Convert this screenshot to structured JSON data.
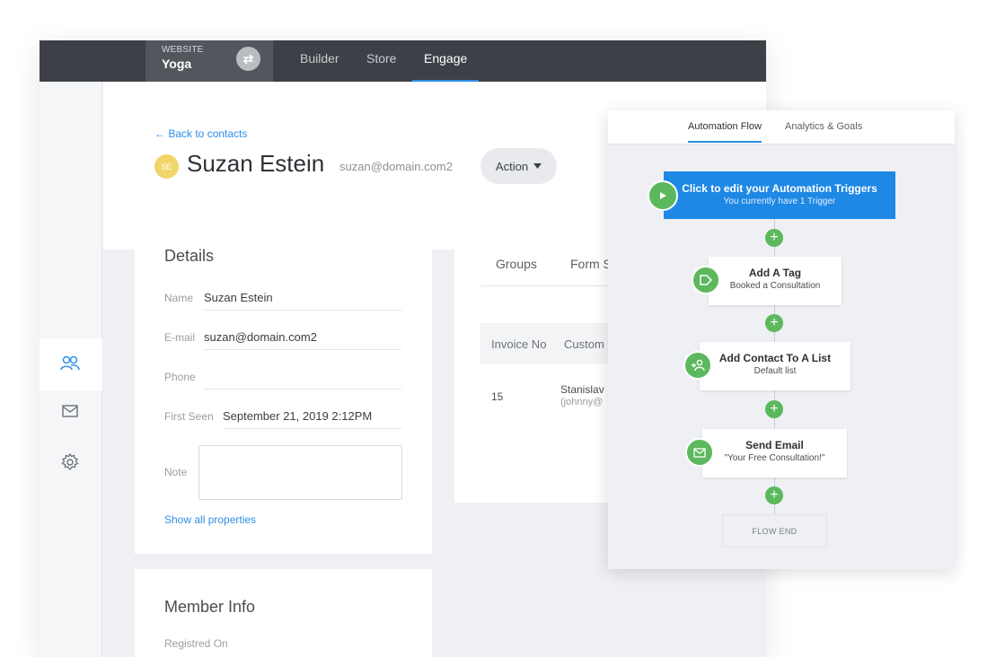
{
  "topbar": {
    "site_kicker": "WEBSITE",
    "site_name": "Yoga",
    "tabs": [
      {
        "label": "Builder"
      },
      {
        "label": "Store"
      },
      {
        "label": "Engage",
        "active": true
      }
    ]
  },
  "rail": {
    "items": [
      {
        "icon": "contacts-icon",
        "active": true
      },
      {
        "icon": "mail-icon"
      },
      {
        "icon": "settings-gear-icon"
      }
    ],
    "help_label": "?"
  },
  "header": {
    "back_link": "← Back to contacts",
    "avatar_initials": "SE",
    "name": "Suzan Estein",
    "email": "suzan@domain.com2",
    "action_label": "Action"
  },
  "details": {
    "title": "Details",
    "fields": [
      {
        "label": "Name",
        "value": "Suzan Estein"
      },
      {
        "label": "E-mail",
        "value": "suzan@domain.com2"
      },
      {
        "label": "Phone",
        "value": ""
      },
      {
        "label": "First Seen",
        "value": "September 21, 2019 2:12PM"
      }
    ],
    "note_label": "Note",
    "show_all": "Show all properties"
  },
  "member": {
    "title": "Member Info",
    "registered_label": "Registred On"
  },
  "right_card": {
    "tabs": [
      "Groups",
      "Form S"
    ],
    "columns": [
      "Invoice No",
      "Custom"
    ],
    "rows": [
      {
        "invoice": "15",
        "customer": "Stanislav",
        "customer_sub": "(johnny@"
      }
    ]
  },
  "flow": {
    "tabs": [
      {
        "label": "Automation Flow",
        "active": true
      },
      {
        "label": "Analytics & Goals"
      }
    ],
    "trigger": {
      "title": "Click to edit your Automation Triggers",
      "subtitle": "You currently have 1 Trigger"
    },
    "steps": [
      {
        "title": "Add A Tag",
        "subtitle": "Booked a Consultation",
        "icon": "tag-icon"
      },
      {
        "title": "Add Contact To A List",
        "subtitle": "Default list",
        "icon": "add-contact-icon"
      },
      {
        "title": "Send Email",
        "subtitle": "\"Your Free Consultation!\"",
        "icon": "email-icon"
      }
    ],
    "end_label": "FLOW END"
  },
  "colors": {
    "topbar": "#3d4046",
    "accent_blue": "#1e88e5",
    "link_blue": "#2f8ee6",
    "flow_green": "#5cb85c",
    "help_red": "#e0334a"
  }
}
